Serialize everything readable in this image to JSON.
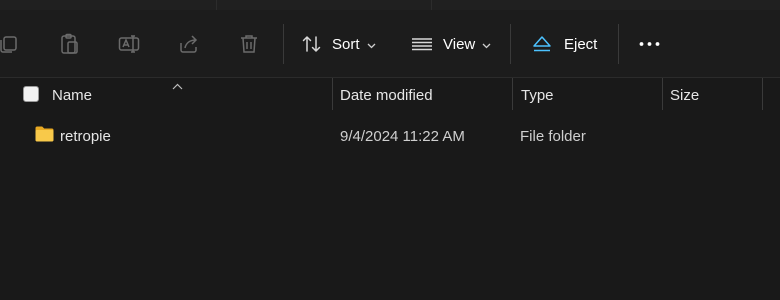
{
  "toolbar": {
    "sort_label": "Sort",
    "view_label": "View",
    "eject_label": "Eject",
    "icons": [
      "copy-icon",
      "paste-icon",
      "rename-icon",
      "share-icon",
      "delete-icon",
      "sort-icon",
      "view-icon",
      "eject-icon",
      "more-icon"
    ]
  },
  "columns": {
    "name": "Name",
    "date_modified": "Date modified",
    "type": "Type",
    "size": "Size"
  },
  "files": [
    {
      "name": "retropie",
      "date_modified": "9/4/2024 11:22 AM",
      "type": "File folder",
      "size": ""
    }
  ],
  "colors": {
    "background": "#191919",
    "folder": "#f8c94a",
    "accent": "#4cc2ff"
  }
}
